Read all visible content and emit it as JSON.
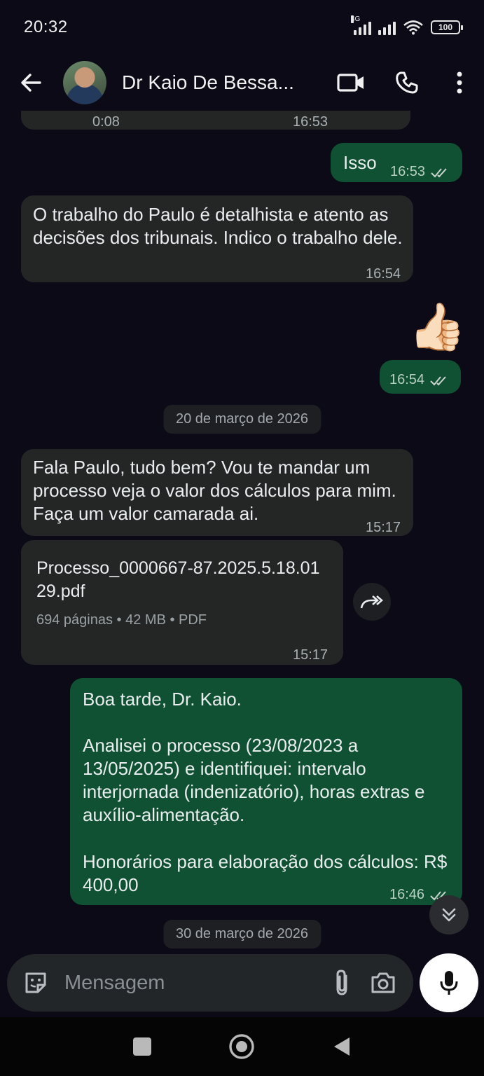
{
  "status_bar": {
    "time": "20:32",
    "network": "4G",
    "battery": "100"
  },
  "header": {
    "contact_name": "Dr Kaio De Bessa..."
  },
  "messages": {
    "audio_partial": {
      "duration": "0:08",
      "time": "16:53"
    },
    "m1": {
      "text": "Isso",
      "time": "16:53"
    },
    "m2": {
      "text": "O trabalho do Paulo é detalhista e atento as decisões dos tribunais. Indico o trabalho dele.",
      "time": "16:54"
    },
    "m3": {
      "emoji": "👍🏻",
      "time": "16:54"
    },
    "date1": "20 de março de 2026",
    "m4": {
      "text": "Fala Paulo, tudo bem? Vou te mandar um processo veja o valor dos cálculos para mim. Faça um valor camarada ai.",
      "time": "15:17"
    },
    "m5": {
      "file_name": "Processo_0000667-87.2025.5.18.0129.pdf",
      "file_meta": "694 páginas • 42 MB • PDF",
      "time": "15:17"
    },
    "m6": {
      "line1": "Boa tarde, Dr. Kaio.",
      "line2": "Analisei o processo (23/08/2023 a 13/05/2025) e identifiquei: intervalo interjornada (indenizatório), horas extras e auxílio-alimentação.",
      "line3": "Honorários para elaboração dos cálculos: R$ 400,00",
      "time": "16:46"
    },
    "date2": "30 de março de 2026"
  },
  "composer": {
    "placeholder": "Mensagem"
  },
  "colors": {
    "incoming": "#242626",
    "outgoing": "#0f5132",
    "background": "#0b0a16",
    "read_ticks": "#c9d4cf"
  },
  "icons": [
    "back-arrow-icon",
    "video-call-icon",
    "phone-icon",
    "more-vert-icon",
    "forward-icon",
    "chevron-double-down-icon",
    "sticker-icon",
    "attach-icon",
    "camera-icon",
    "mic-icon",
    "nav-recents-icon",
    "nav-home-icon",
    "nav-back-icon"
  ]
}
